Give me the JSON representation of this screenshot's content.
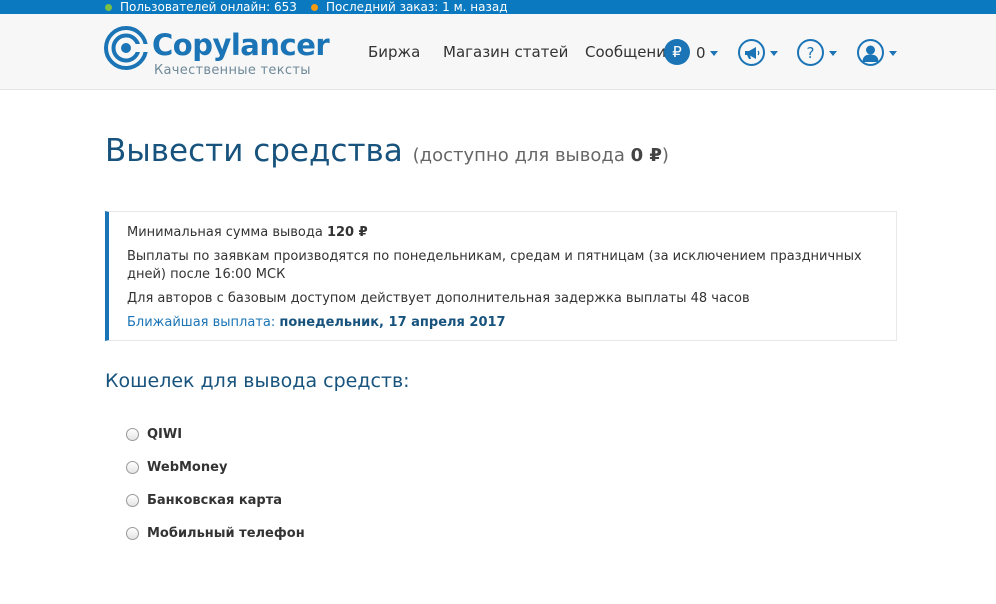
{
  "statusbar": {
    "online": "Пользователей онлайн: 653",
    "online_color": "#7bc043",
    "last_order": "Последний заказ: 1 м. назад",
    "last_order_color": "#f39c12"
  },
  "header": {
    "logo_name": "Copylancer",
    "logo_tagline": "Качественные тексты",
    "nav": {
      "exchange": "Биржа",
      "shop": "Магазин статей",
      "messages": "Сообщения"
    },
    "currency_icon": "₽",
    "balance": "0",
    "icons": [
      "megaphone-icon",
      "help-icon",
      "user-icon"
    ]
  },
  "main": {
    "title": "Вывести средства",
    "title_sub_prefix": "(доступно для вывода ",
    "title_sub_amount": "0 ₽",
    "title_sub_suffix": ")",
    "info": {
      "min_prefix": "Минимальная сумма вывода ",
      "min_amount": "120 ₽",
      "schedule": "Выплаты по заявкам производятся по понедельникам, средам и пятницам (за исключением праздничных дней) после 16:00 МСК",
      "delay": "Для авторов с базовым доступом действует дополнительная задержка выплаты 48 часов",
      "nearest_prefix": "Ближайшая выплата: ",
      "nearest_date": "понедельник, 17 апреля 2017"
    },
    "wallet_title": "Кошелек для вывода средств:",
    "wallets": [
      "QIWI",
      "WebMoney",
      "Банковская карта",
      "Мобильный телефон"
    ]
  },
  "colors": {
    "brand": "#1a74b5",
    "title": "#17537d",
    "statusbar": "#0a79bf"
  }
}
